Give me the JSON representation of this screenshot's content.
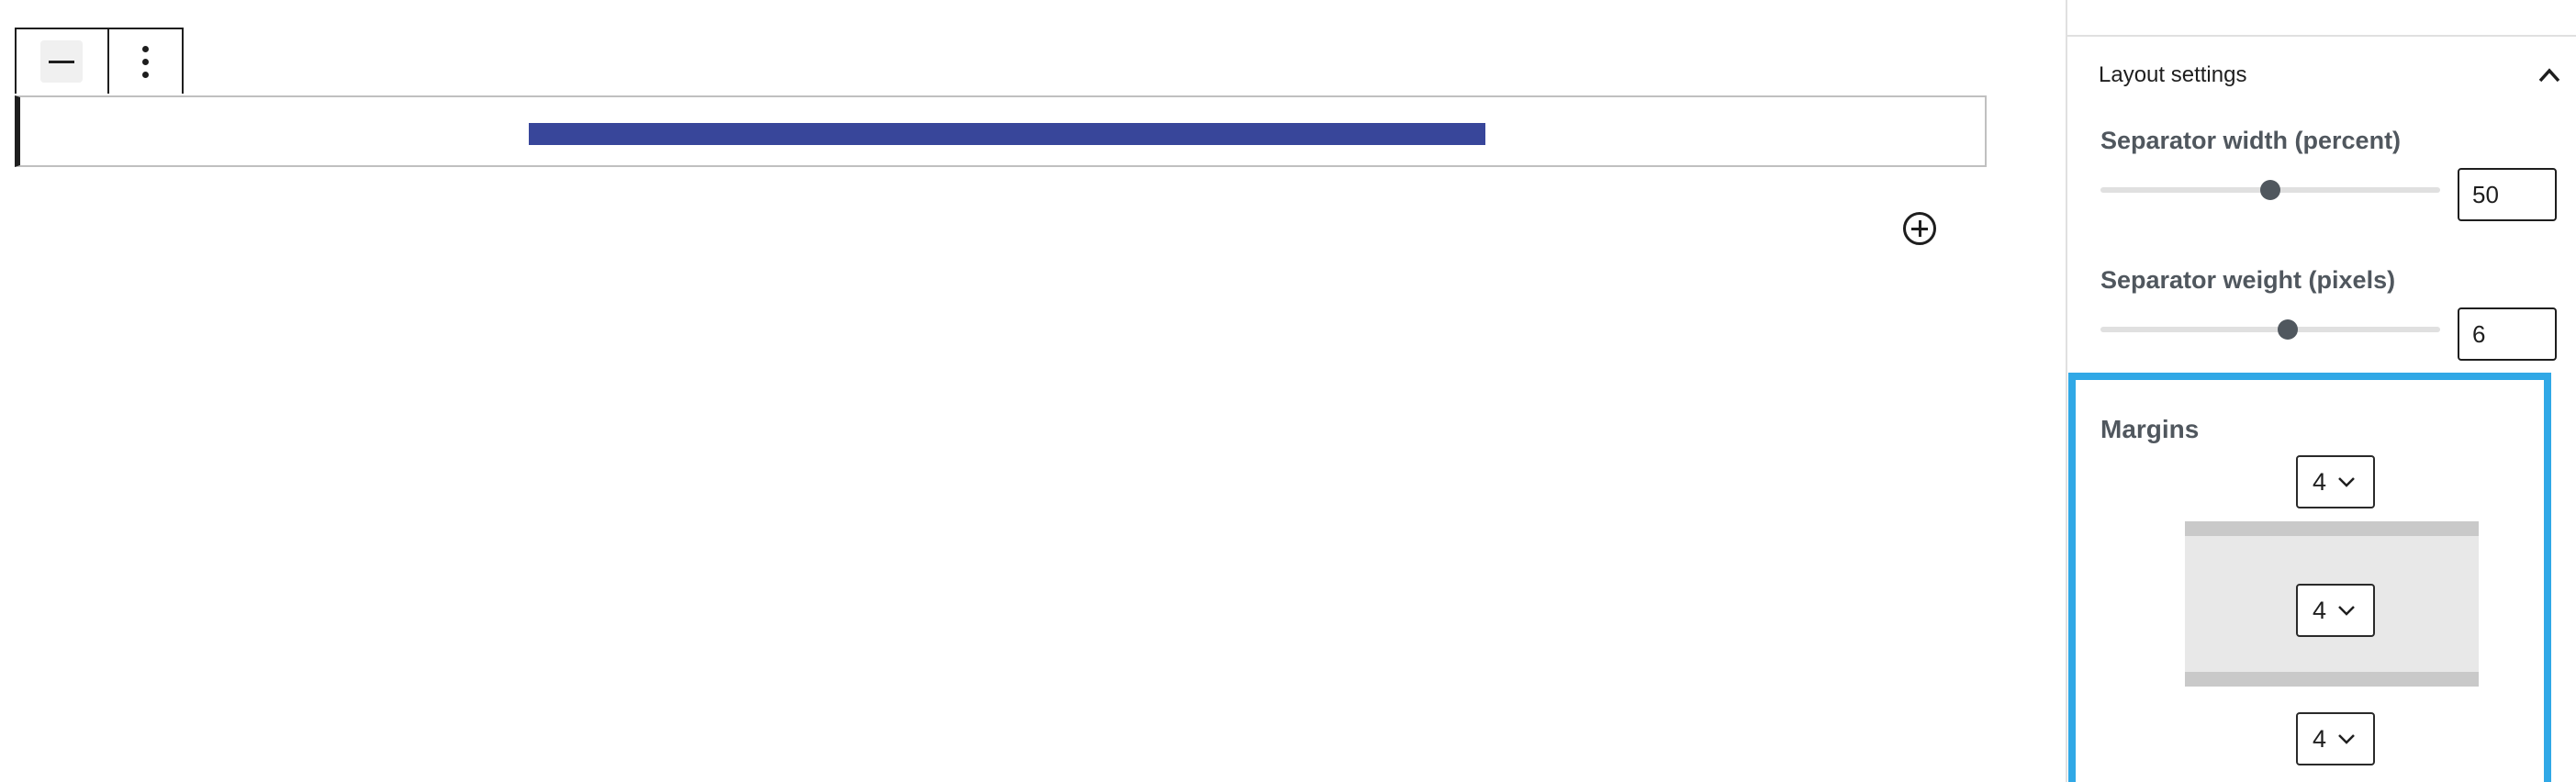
{
  "editor": {
    "separator_color": "#38469a"
  },
  "sidebar": {
    "panel_title": "Layout settings",
    "separator_width": {
      "label": "Separator width (percent)",
      "value": "50",
      "slider_fraction": 0.5
    },
    "separator_weight": {
      "label": "Separator weight (pixels)",
      "value": "6",
      "slider_fraction": 0.55
    },
    "margins": {
      "label": "Margins",
      "top": "4",
      "middle": "4",
      "bottom": "4",
      "highlight_color": "#30a8e6"
    }
  },
  "icons": {
    "toolbar_block": "separator-icon",
    "toolbar_more": "more-vertical-icon",
    "add": "plus-circle-icon",
    "panel_toggle": "chevron-up-icon",
    "select": "chevron-down-icon"
  }
}
